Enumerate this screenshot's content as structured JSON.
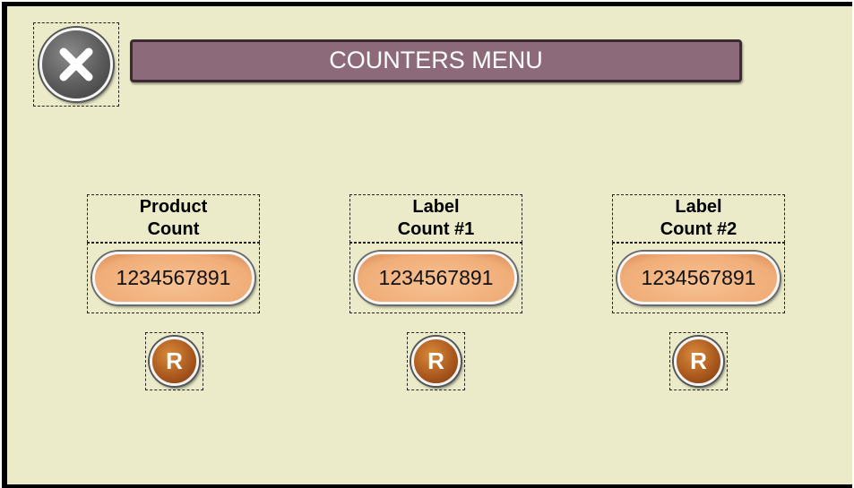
{
  "title": "COUNTERS MENU",
  "counters": [
    {
      "label": "Product\nCount",
      "value": "1234567891",
      "reset_label": "R"
    },
    {
      "label": "Label\nCount #1",
      "value": "1234567891",
      "reset_label": "R"
    },
    {
      "label": "Label\nCount #2",
      "value": "1234567891",
      "reset_label": "R"
    }
  ],
  "icons": {
    "close": "close-x-icon"
  },
  "colors": {
    "background": "#ebebc9",
    "title_bar": "#8c6a7a",
    "counter_pill": "#f0ad78",
    "reset_button": "#a7561c",
    "close_button": "#5b5b5b"
  }
}
